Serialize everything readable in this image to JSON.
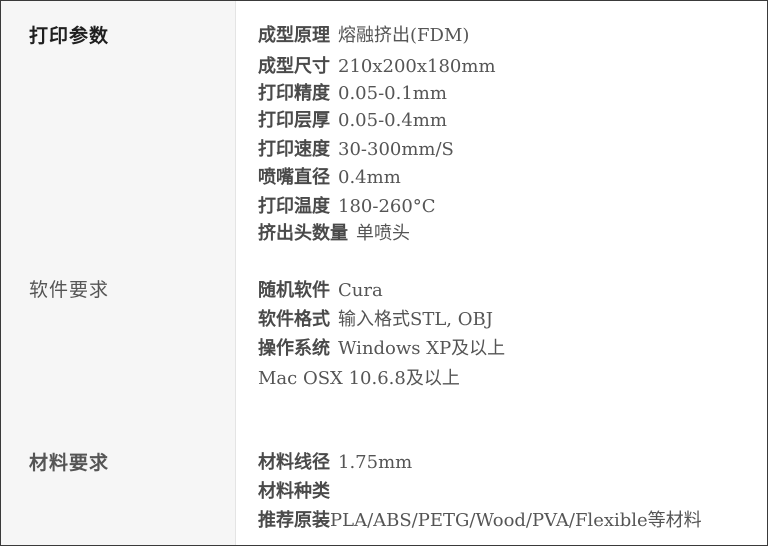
{
  "sections": {
    "print_params": {
      "heading": "打印参数",
      "rows": [
        {
          "label": "成型原理",
          "value": "熔融挤出(FDM)"
        },
        {
          "label": "成型尺寸",
          "value": "210x200x180mm"
        },
        {
          "label": "打印精度",
          "value": "0.05-0.1mm"
        },
        {
          "label": "打印层厚",
          "value": "0.05-0.4mm"
        },
        {
          "label": "打印速度",
          "value": "30-300mm/S"
        },
        {
          "label": "喷嘴直径",
          "value": "0.4mm"
        },
        {
          "label": "打印温度",
          "value": "180-260°C"
        },
        {
          "label": "挤出头数量",
          "value": "单喷头"
        }
      ]
    },
    "software_req": {
      "heading": "软件要求",
      "rows": [
        {
          "label": "随机软件",
          "value": "Cura"
        },
        {
          "label": "软件格式",
          "value": "输入格式STL, OBJ"
        },
        {
          "label": "操作系统",
          "value": "Windows XP及以上"
        },
        {
          "label": "",
          "value": "Mac OSX 10.6.8及以上"
        }
      ]
    },
    "material_req": {
      "heading": "材料要求",
      "rows": [
        {
          "label": "材料线径",
          "value": "1.75mm"
        },
        {
          "label": "材料种类",
          "value": ""
        },
        {
          "label": "推荐原装",
          "value": "PLA/ABS/PETG/Wood/PVA/Flexible等材料"
        }
      ]
    }
  }
}
